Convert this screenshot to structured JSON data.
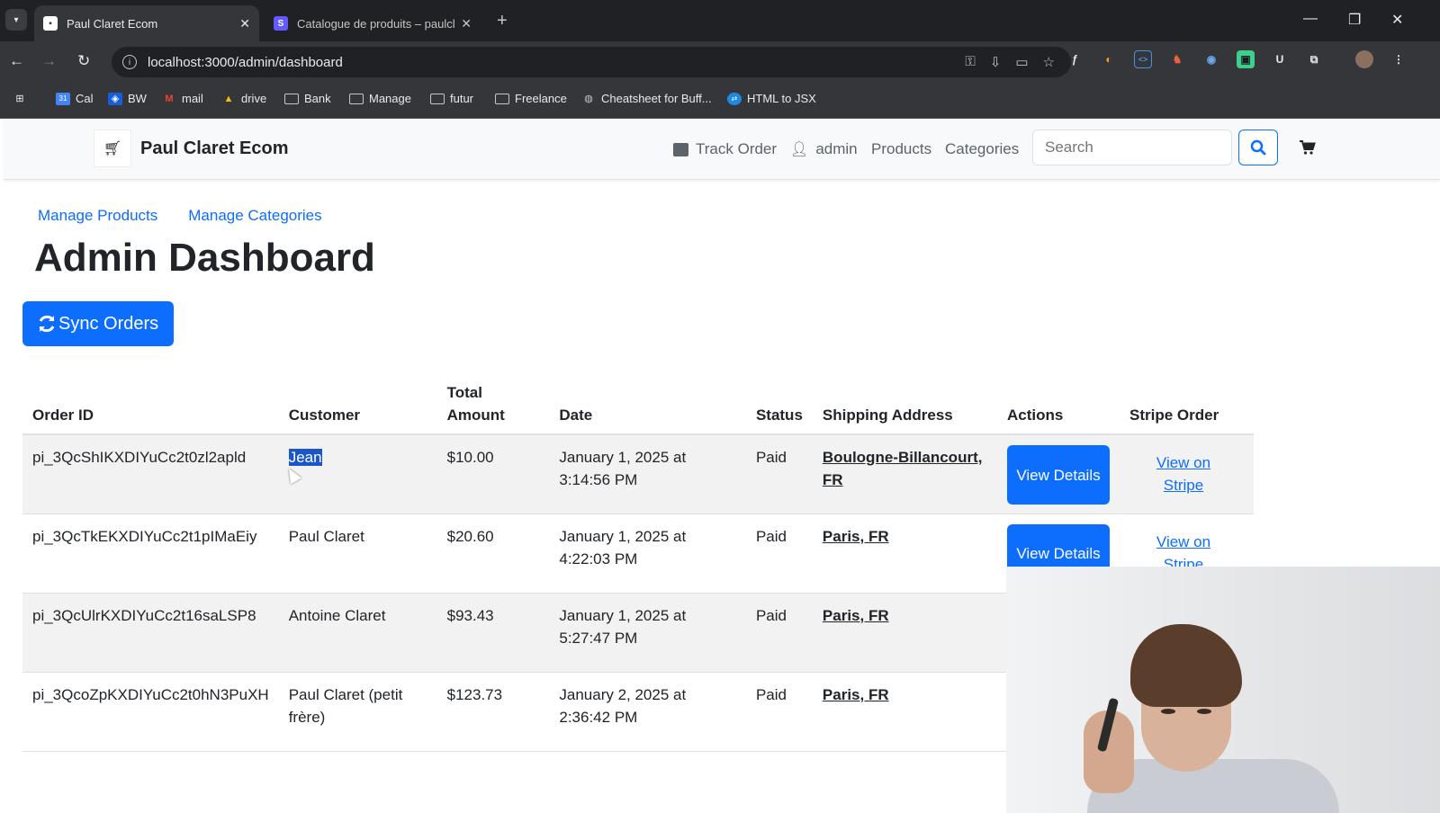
{
  "browser": {
    "tabs": [
      {
        "title": "Paul Claret Ecom",
        "active": true
      },
      {
        "title": "Catalogue de produits – paulcla",
        "active": false
      }
    ],
    "favicon_stripe": "S",
    "url": "localhost:3000/admin/dashboard",
    "bookmarks": [
      {
        "label": "Cal",
        "icon": "calendar-icon"
      },
      {
        "label": "BW",
        "icon": "bitwarden-icon"
      },
      {
        "label": "mail",
        "icon": "gmail-icon"
      },
      {
        "label": "drive",
        "icon": "drive-icon"
      },
      {
        "label": "Bank",
        "icon": "folder-icon"
      },
      {
        "label": "Manage",
        "icon": "folder-icon"
      },
      {
        "label": "futur",
        "icon": "folder-icon"
      },
      {
        "label": "Freelance",
        "icon": "folder-icon"
      },
      {
        "label": "Cheatsheet for Buff...",
        "icon": "globe-icon"
      },
      {
        "label": "HTML to JSX",
        "icon": "transform-icon"
      }
    ]
  },
  "navbar": {
    "brand": "Paul Claret Ecom",
    "links": {
      "track_order": "Track Order",
      "admin": "admin",
      "products": "Products",
      "categories": "Categories"
    },
    "search_placeholder": "Search"
  },
  "admin": {
    "manage_products": "Manage Products",
    "manage_categories": "Manage Categories",
    "title": "Admin Dashboard",
    "sync_label": "Sync Orders"
  },
  "table": {
    "headers": {
      "order_id": "Order ID",
      "customer": "Customer",
      "total_amount": "Total Amount",
      "date": "Date",
      "status": "Status",
      "shipping": "Shipping Address",
      "actions": "Actions",
      "stripe": "Stripe Order"
    },
    "action_label": "View Details",
    "stripe_label": "View on Stripe",
    "rows": [
      {
        "order_id": "pi_3QcShIKXDIYuCc2t0zl2apld",
        "customer": "Jean",
        "amount": "$10.00",
        "date": "January 1, 2025 at 3:14:56 PM",
        "status": "Paid",
        "address": "Boulogne-Billancourt, FR"
      },
      {
        "order_id": "pi_3QcTkEKXDIYuCc2t1pIMaEiy",
        "customer": "Paul Claret",
        "amount": "$20.60",
        "date": "January 1, 2025 at 4:22:03 PM",
        "status": "Paid",
        "address": "Paris, FR"
      },
      {
        "order_id": "pi_3QcUlrKXDIYuCc2t16saLSP8",
        "customer": "Antoine Claret",
        "amount": "$93.43",
        "date": "January 1, 2025 at 5:27:47 PM",
        "status": "Paid",
        "address": "Paris, FR"
      },
      {
        "order_id": "pi_3QcoZpKXDIYuCc2t0hN3PuXH",
        "customer": "Paul Claret (petit frère)",
        "amount": "$123.73",
        "date": "January 2, 2025 at 2:36:42 PM",
        "status": "Paid",
        "address": "Paris, FR"
      }
    ]
  },
  "colors": {
    "primary": "#0d6efd",
    "chrome_dark": "#202124",
    "selection": "#1a56c7"
  }
}
